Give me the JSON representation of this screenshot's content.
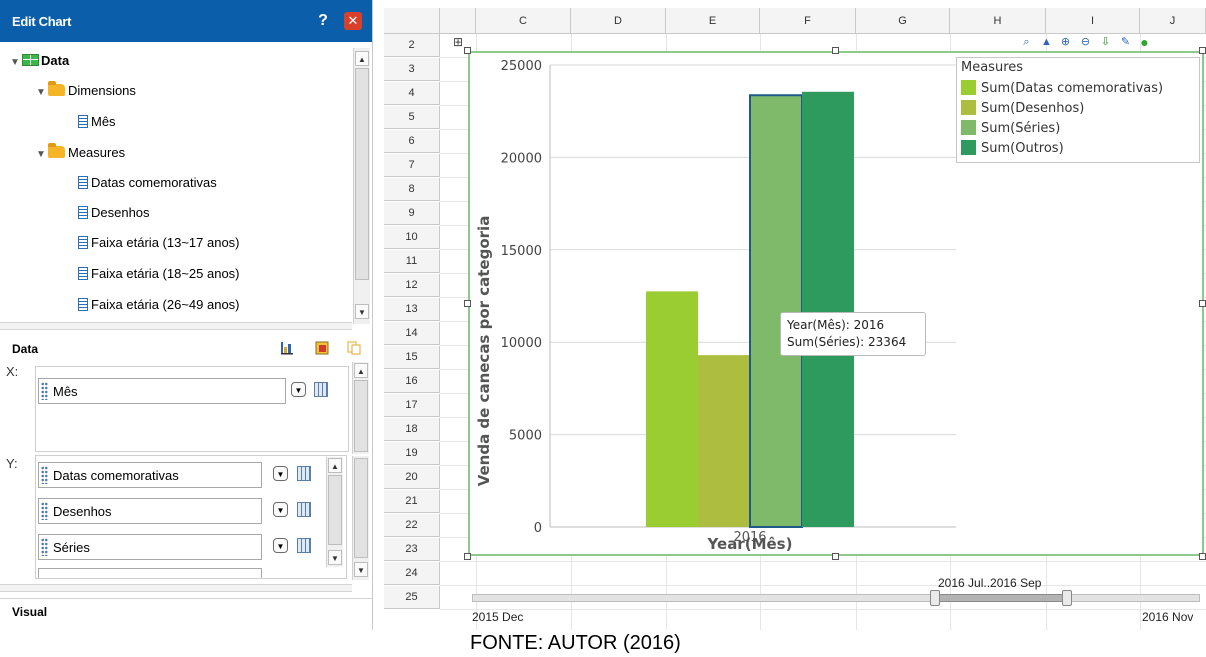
{
  "panel": {
    "title": "Edit Chart",
    "help_icon": "question-mark-icon",
    "close_icon": "close-icon"
  },
  "tree": {
    "root": "Data",
    "dimensions_label": "Dimensions",
    "dimensions": [
      "Mês"
    ],
    "measures_label": "Measures",
    "measures": [
      "Datas comemorativas",
      "Desenhos",
      "Faixa etária (13~17 anos)",
      "Faixa etária (18~25 anos)",
      "Faixa etária (26~49 anos)"
    ]
  },
  "data_section": {
    "title": "Data",
    "x_label": "X:",
    "x_fields": [
      "Mês"
    ],
    "y_label": "Y:",
    "y_fields": [
      "Datas comemorativas",
      "Desenhos",
      "Séries"
    ]
  },
  "visual_section": {
    "title": "Visual"
  },
  "sheet": {
    "columns": [
      "C",
      "D",
      "E",
      "F",
      "G",
      "H",
      "I",
      "J"
    ],
    "rows": [
      "2",
      "3",
      "4",
      "5",
      "6",
      "7",
      "8",
      "9",
      "10",
      "11",
      "12",
      "13",
      "14",
      "15",
      "16",
      "17",
      "18",
      "19",
      "20",
      "21",
      "22",
      "23",
      "24",
      "25"
    ]
  },
  "chart_data": {
    "type": "bar",
    "categories": [
      "2016"
    ],
    "series": [
      {
        "name": "Sum(Datas comemorativas)",
        "values": [
          12750
        ],
        "color": "#9acd32"
      },
      {
        "name": "Sum(Desenhos)",
        "values": [
          9300
        ],
        "color": "#adbd40"
      },
      {
        "name": "Sum(Séries)",
        "values": [
          23364
        ],
        "color": "#7fba6a"
      },
      {
        "name": "Sum(Outros)",
        "values": [
          23550
        ],
        "color": "#2e9a5e"
      }
    ],
    "xlabel": "Year(Mês)",
    "ylabel": "Venda de canecas por categoria",
    "ylim": [
      0,
      25000
    ],
    "yticks": [
      "0",
      "5000",
      "10000",
      "15000",
      "20000",
      "25000"
    ],
    "legend_title": "Measures",
    "legend_position": "top-right",
    "highlighted_series": "Sum(Séries)"
  },
  "tooltip": {
    "line1": "Year(Mês): 2016",
    "line2": "Sum(Séries): 23364"
  },
  "range_slider": {
    "start_label": "2015 Dec",
    "end_label": "2016 Nov",
    "selection_label": "2016 Jul..2016 Sep"
  },
  "caption": "FONTE: AUTOR (2016)"
}
